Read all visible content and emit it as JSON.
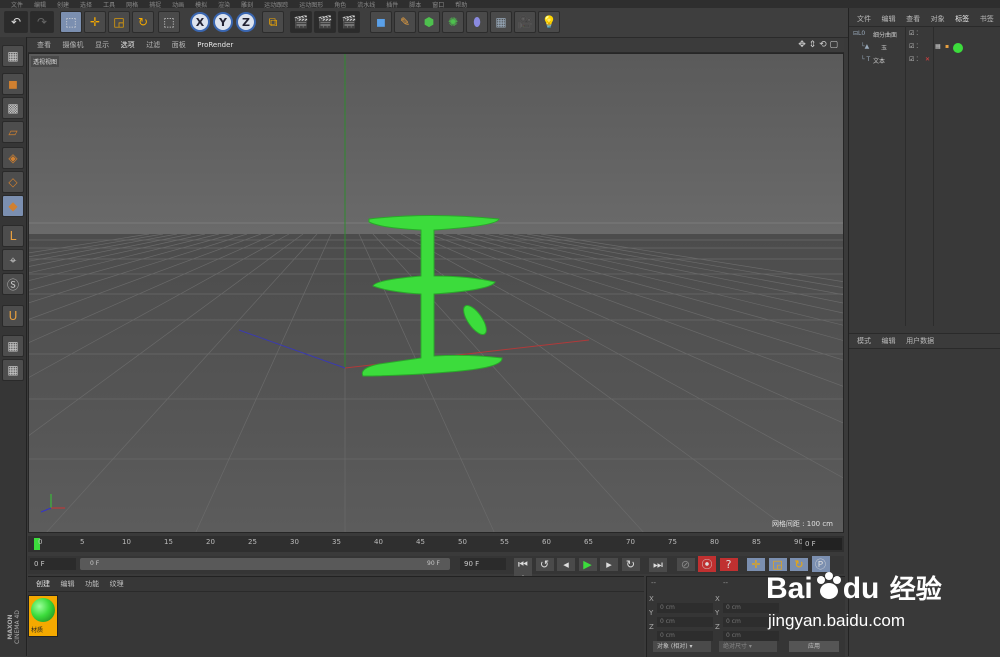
{
  "menubar": {
    "items": [
      "文件",
      "编辑",
      "创建",
      "选择",
      "工具",
      "网格",
      "捕捉",
      "动画",
      "模拟",
      "渲染",
      "雕刻",
      "运动跟踪",
      "运动图形",
      "角色",
      "流水线",
      "插件",
      "脚本",
      "窗口",
      "帮助"
    ]
  },
  "toolbar": {
    "axis_x": "X",
    "axis_y": "Y",
    "axis_z": "Z"
  },
  "viewport_menu": {
    "items": [
      "查看",
      "摄像机",
      "显示",
      "选项",
      "过滤",
      "面板",
      "ProRender"
    ]
  },
  "viewport": {
    "label": "透视视图",
    "grid_spacing": "网格间距 : 100 cm",
    "object_color": "#3cdc3c"
  },
  "object_manager": {
    "tabs": [
      "文件",
      "编辑",
      "查看",
      "对象",
      "标签",
      "书签"
    ],
    "rows": [
      {
        "name": "细分曲面"
      },
      {
        "name": "玉"
      },
      {
        "name": "文本"
      }
    ]
  },
  "attribute_manager": {
    "tabs": [
      "模式",
      "编辑",
      "用户数据"
    ]
  },
  "timeline": {
    "ticks": [
      "0",
      "5",
      "10",
      "15",
      "20",
      "25",
      "30",
      "35",
      "40",
      "45",
      "50",
      "55",
      "60",
      "65",
      "70",
      "75",
      "80",
      "85",
      "90"
    ],
    "current_frame_right": "0 F"
  },
  "timebar": {
    "start": "0 F",
    "range_start": "0 F",
    "range_end": "90 F",
    "end": "90 F"
  },
  "material_manager": {
    "tabs": [
      "创建",
      "编辑",
      "功能",
      "纹理"
    ],
    "material_name": "材质"
  },
  "coordinates": {
    "header_left": "--",
    "header_right": "--",
    "rows": [
      {
        "axis": "X",
        "pos": "0 cm",
        "axis2": "X",
        "size": "0 cm"
      },
      {
        "axis": "Y",
        "pos": "0 cm",
        "axis2": "Y",
        "size": "0 cm"
      },
      {
        "axis": "Z",
        "pos": "0 cm",
        "axis2": "Z",
        "size": "0 cm"
      }
    ],
    "mode_select": "对象 (相对)",
    "size_select": "绝对尺寸",
    "apply_button": "应用"
  },
  "watermark": {
    "brand": "Bai",
    "brand2": "du",
    "brand_cn": "经验",
    "url": "jingyan.baidu.com"
  },
  "logo": {
    "line1": "MAXON",
    "line2": "CINEMA 4D"
  }
}
